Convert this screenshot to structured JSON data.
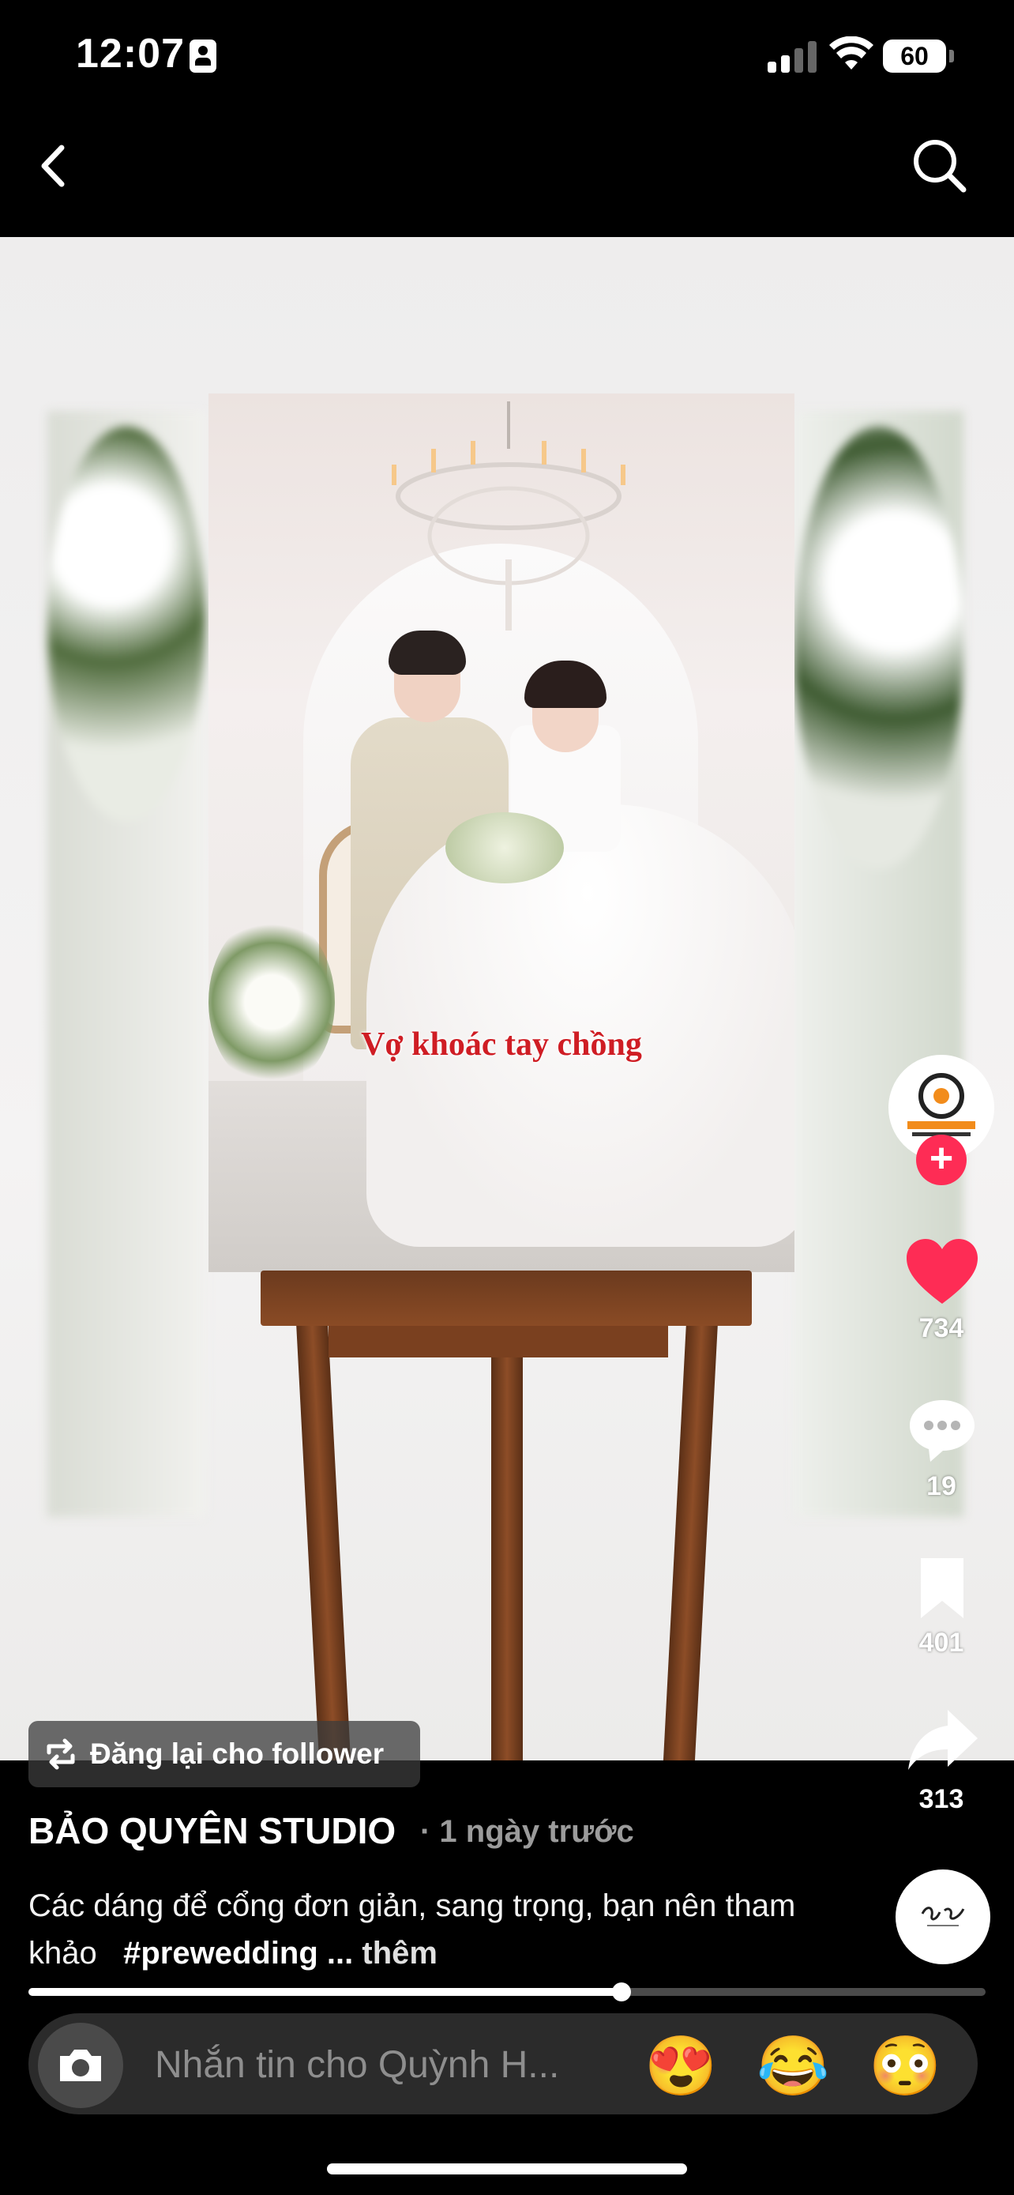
{
  "status_bar": {
    "time": "12:07",
    "battery": "60"
  },
  "video": {
    "overlay_caption": "Vợ khoác tay chồng"
  },
  "actions": {
    "likes": "734",
    "comments": "19",
    "saves": "401",
    "shares": "313"
  },
  "post": {
    "repost_label": "Đăng lại cho follower",
    "author": "BẢO QUYÊN STUDIO",
    "time": "· 1 ngày trước",
    "description": "Các dáng để cổng đơn giản, sang trọng, bạn nên tham khảo",
    "hashtag": "#prewedding ...",
    "more": "thêm",
    "progress": 0.62
  },
  "message_bar": {
    "placeholder": "Nhắn tin cho Quỳnh H...",
    "emojis": [
      "😍",
      "😂",
      "😳"
    ]
  },
  "colors": {
    "accent": "#fe2c55",
    "caption_red": "#cf1d24"
  }
}
